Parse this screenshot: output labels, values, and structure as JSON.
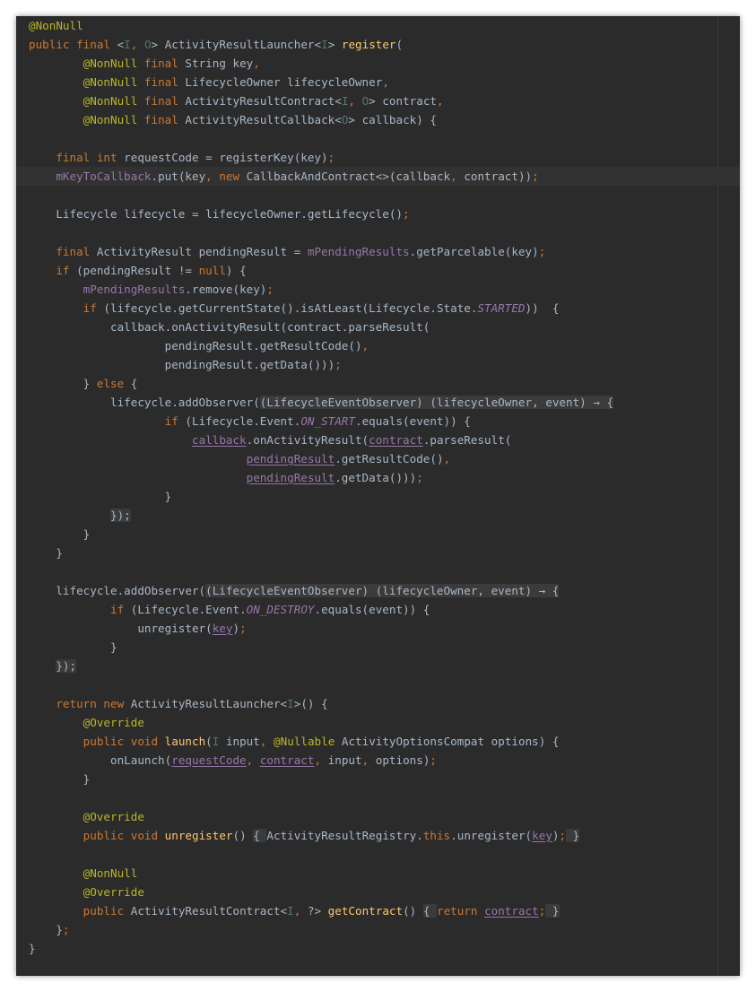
{
  "editor": {
    "language": "java",
    "theme": "darcula",
    "current_line_index": 8,
    "lines": [
      [
        [
          "a",
          "@NonNull"
        ]
      ],
      [
        [
          "k",
          "public final "
        ],
        [
          "",
          "<"
        ],
        [
          "tp",
          "I"
        ],
        [
          "k",
          ", "
        ],
        [
          "tp",
          "O"
        ],
        [
          "",
          "> ActivityResultLauncher<"
        ],
        [
          "tp",
          "I"
        ],
        [
          "",
          "> "
        ],
        [
          "m",
          "register"
        ],
        [
          "",
          "("
        ]
      ],
      [
        [
          "",
          "        "
        ],
        [
          "a",
          "@NonNull "
        ],
        [
          "k",
          "final "
        ],
        [
          "",
          "String key"
        ],
        [
          "k",
          ","
        ]
      ],
      [
        [
          "",
          "        "
        ],
        [
          "a",
          "@NonNull "
        ],
        [
          "k",
          "final "
        ],
        [
          "",
          "LifecycleOwner lifecycleOwner"
        ],
        [
          "k",
          ","
        ]
      ],
      [
        [
          "",
          "        "
        ],
        [
          "a",
          "@NonNull "
        ],
        [
          "k",
          "final "
        ],
        [
          "",
          "ActivityResultContract<"
        ],
        [
          "tp",
          "I"
        ],
        [
          "k",
          ", "
        ],
        [
          "tp",
          "O"
        ],
        [
          "",
          "> contract"
        ],
        [
          "k",
          ","
        ]
      ],
      [
        [
          "",
          "        "
        ],
        [
          "a",
          "@NonNull "
        ],
        [
          "k",
          "final "
        ],
        [
          "",
          "ActivityResultCallback<"
        ],
        [
          "tp",
          "O"
        ],
        [
          "",
          "> callback) {"
        ]
      ],
      [],
      [
        [
          "",
          "    "
        ],
        [
          "k",
          "final int "
        ],
        [
          "",
          "requestCode = registerKey(key)"
        ],
        [
          "k",
          ";"
        ]
      ],
      [
        [
          "",
          "    "
        ],
        [
          "f",
          "mKeyToCallback"
        ],
        [
          "",
          ".put(key"
        ],
        [
          "k",
          ", new "
        ],
        [
          "",
          "CallbackAndContract<>(callback"
        ],
        [
          "k",
          ", "
        ],
        [
          "",
          "contract))"
        ],
        [
          "k",
          ";"
        ]
      ],
      [],
      [
        [
          "",
          "    Lifecycle lifecycle = lifecycleOwner.getLifecycle()"
        ],
        [
          "k",
          ";"
        ]
      ],
      [],
      [
        [
          "",
          "    "
        ],
        [
          "k",
          "final "
        ],
        [
          "",
          "ActivityResult pendingResult = "
        ],
        [
          "f",
          "mPendingResults"
        ],
        [
          "",
          ".getParcelable(key)"
        ],
        [
          "k",
          ";"
        ]
      ],
      [
        [
          "",
          "    "
        ],
        [
          "k",
          "if "
        ],
        [
          "",
          "(pendingResult != "
        ],
        [
          "k",
          "null"
        ],
        [
          "",
          ") {"
        ]
      ],
      [
        [
          "",
          "        "
        ],
        [
          "f",
          "mPendingResults"
        ],
        [
          "",
          ".remove(key)"
        ],
        [
          "k",
          ";"
        ]
      ],
      [
        [
          "",
          "        "
        ],
        [
          "k",
          "if "
        ],
        [
          "",
          "(lifecycle.getCurrentState().isAtLeast(Lifecycle.State."
        ],
        [
          "f it",
          "STARTED"
        ],
        [
          "",
          "))  {"
        ]
      ],
      [
        [
          "",
          "            callback.onActivityResult(contract.parseResult("
        ]
      ],
      [
        [
          "",
          "                    pendingResult.getResultCode()"
        ],
        [
          "k",
          ","
        ]
      ],
      [
        [
          "",
          "                    pendingResult.getData()))"
        ],
        [
          "k",
          ";"
        ]
      ],
      [
        [
          "",
          "        } "
        ],
        [
          "k",
          "else "
        ],
        [
          "",
          "{"
        ]
      ],
      [
        [
          "",
          "            lifecycle.addObserver("
        ],
        [
          "fold",
          "(LifecycleEventObserver) (lifecycleOwner, event) → {"
        ]
      ],
      [
        [
          "",
          "                    "
        ],
        [
          "k",
          "if "
        ],
        [
          "",
          "(Lifecycle.Event."
        ],
        [
          "f it",
          "ON_START"
        ],
        [
          "",
          ".equals(event)) {"
        ]
      ],
      [
        [
          "",
          "                        "
        ],
        [
          "f ul",
          "callback"
        ],
        [
          "",
          ".onActivityResult("
        ],
        [
          "f ul",
          "contract"
        ],
        [
          "",
          ".parseResult("
        ]
      ],
      [
        [
          "",
          "                                "
        ],
        [
          "f ul",
          "pendingResult"
        ],
        [
          "",
          ".getResultCode()"
        ],
        [
          "k",
          ","
        ]
      ],
      [
        [
          "",
          "                                "
        ],
        [
          "f ul",
          "pendingResult"
        ],
        [
          "",
          ".getData()))"
        ],
        [
          "k",
          ";"
        ]
      ],
      [
        [
          "",
          "                    }"
        ]
      ],
      [
        [
          "",
          "            "
        ],
        [
          "fold",
          "});"
        ]
      ],
      [
        [
          "",
          "        }"
        ]
      ],
      [
        [
          "",
          "    }"
        ]
      ],
      [],
      [
        [
          "",
          "    lifecycle.addObserver("
        ],
        [
          "fold",
          "(LifecycleEventObserver) (lifecycleOwner, event) → {"
        ]
      ],
      [
        [
          "",
          "            "
        ],
        [
          "k",
          "if "
        ],
        [
          "",
          "(Lifecycle.Event."
        ],
        [
          "f it",
          "ON_DESTROY"
        ],
        [
          "",
          ".equals(event)) {"
        ]
      ],
      [
        [
          "",
          "                unregister("
        ],
        [
          "f ul",
          "key"
        ],
        [
          "",
          ")"
        ],
        [
          "k",
          ";"
        ]
      ],
      [
        [
          "",
          "            }"
        ]
      ],
      [
        [
          "",
          "    "
        ],
        [
          "fold",
          "});"
        ]
      ],
      [],
      [
        [
          "",
          "    "
        ],
        [
          "k",
          "return new "
        ],
        [
          "",
          "ActivityResultLauncher<"
        ],
        [
          "tp",
          "I"
        ],
        [
          "",
          ">() {"
        ]
      ],
      [
        [
          "",
          "        "
        ],
        [
          "a",
          "@Override"
        ]
      ],
      [
        [
          "",
          "        "
        ],
        [
          "k",
          "public void "
        ],
        [
          "m",
          "launch"
        ],
        [
          "",
          "("
        ],
        [
          "tp",
          "I "
        ],
        [
          "",
          "input"
        ],
        [
          "k",
          ", "
        ],
        [
          "a",
          "@Nullable "
        ],
        [
          "",
          "ActivityOptionsCompat options) {"
        ]
      ],
      [
        [
          "",
          "            onLaunch("
        ],
        [
          "f ul",
          "requestCode"
        ],
        [
          "k",
          ", "
        ],
        [
          "f ul",
          "contract"
        ],
        [
          "k",
          ", "
        ],
        [
          "",
          "input"
        ],
        [
          "k",
          ", "
        ],
        [
          "",
          "options)"
        ],
        [
          "k",
          ";"
        ]
      ],
      [
        [
          "",
          "        }"
        ]
      ],
      [],
      [
        [
          "",
          "        "
        ],
        [
          "a",
          "@Override"
        ]
      ],
      [
        [
          "",
          "        "
        ],
        [
          "k",
          "public void "
        ],
        [
          "m",
          "unregister"
        ],
        [
          "",
          "() "
        ],
        [
          "fold",
          "{ "
        ],
        [
          "",
          "ActivityResultRegistry."
        ],
        [
          "k",
          "this"
        ],
        [
          "",
          ".unregister("
        ],
        [
          "f ul",
          "key"
        ],
        [
          "",
          ")"
        ],
        [
          "k",
          ";"
        ],
        [
          "fold",
          " }"
        ]
      ],
      [],
      [
        [
          "",
          "        "
        ],
        [
          "a",
          "@NonNull"
        ]
      ],
      [
        [
          "",
          "        "
        ],
        [
          "a",
          "@Override"
        ]
      ],
      [
        [
          "",
          "        "
        ],
        [
          "k",
          "public "
        ],
        [
          "",
          "ActivityResultContract<"
        ],
        [
          "tp",
          "I"
        ],
        [
          "k",
          ", "
        ],
        [
          "",
          "?> "
        ],
        [
          "m",
          "getContract"
        ],
        [
          "",
          "() "
        ],
        [
          "fold",
          "{ "
        ],
        [
          "k",
          "return "
        ],
        [
          "f ul",
          "contract"
        ],
        [
          "k",
          ";"
        ],
        [
          "fold",
          " }"
        ]
      ],
      [
        [
          "",
          "    }"
        ],
        [
          "k",
          ";"
        ]
      ],
      [
        [
          "",
          "}"
        ]
      ]
    ]
  }
}
